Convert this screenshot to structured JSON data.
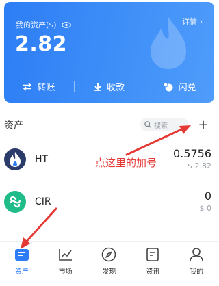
{
  "card": {
    "label": "我的资产($)",
    "details": "详情 ›",
    "total": "2.82",
    "actions": [
      {
        "label": "转账",
        "icon": "transfer-icon"
      },
      {
        "label": "收款",
        "icon": "receive-icon"
      },
      {
        "label": "闪兑",
        "icon": "flash-swap-icon"
      }
    ]
  },
  "assets": {
    "title": "资产",
    "search_placeholder": "搜索",
    "add_label": "+"
  },
  "tokens": [
    {
      "name": "HT",
      "quantity": "0.5756",
      "value": "$ 2.82"
    },
    {
      "name": "CIR",
      "quantity": "0",
      "value": "$ 0"
    }
  ],
  "annotation": "点这里的加号",
  "nav": [
    {
      "label": "资产",
      "icon": "wallet-icon",
      "active": true
    },
    {
      "label": "市场",
      "icon": "market-chart-icon",
      "active": false
    },
    {
      "label": "发现",
      "icon": "compass-icon",
      "active": false
    },
    {
      "label": "资讯",
      "icon": "news-icon",
      "active": false
    },
    {
      "label": "我的",
      "icon": "profile-icon",
      "active": false
    }
  ],
  "colors": {
    "brand_blue": "#2d7df6",
    "annotation_red": "#e53935",
    "ht_logo": "#2b3b6a",
    "cir_logo": "#1fbc8a"
  }
}
